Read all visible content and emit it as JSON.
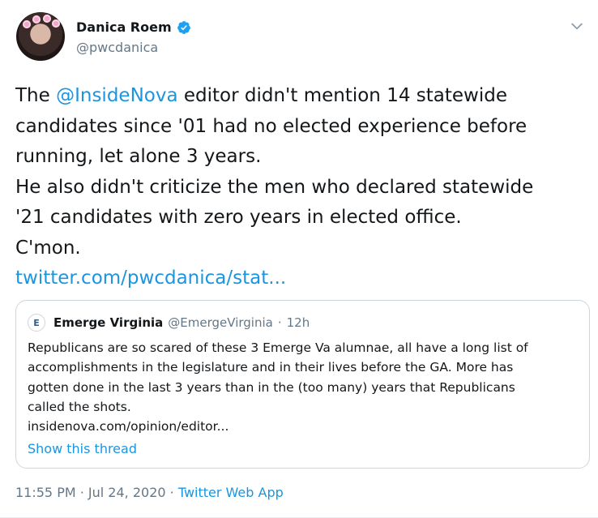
{
  "tweet": {
    "display_name": "Danica Roem",
    "handle": "@pwcdanica",
    "text_lines": [
      {
        "before": "The ",
        "mention": "@InsideNova",
        "after": " editor didn't mention 14 statewide"
      },
      "candidates since '01 had no elected experience before",
      "running, let alone 3 years.",
      "He also didn't criticize the men who declared statewide",
      "'21 candidates with zero years in elected office.",
      "C'mon."
    ],
    "link": "twitter.com/pwcdanica/stat..."
  },
  "quote": {
    "avatar_letter": "E",
    "name": "Emerge Virginia",
    "handle": "@EmergeVirginia",
    "separator": "·",
    "time": "12h",
    "text_lines": [
      "Republicans are so scared of these 3 Emerge Va alumnae, all  have a long list of",
      "accomplishments in the legislature and in their lives before the GA. More has",
      "gotten done in the last 3 years than in the (too many) years that Republicans",
      "called the shots.",
      "insidenova.com/opinion/editor..."
    ],
    "show_thread": "Show this thread"
  },
  "footer": {
    "timestamp": "11:55 PM · Jul 24, 2020",
    "separator": " · ",
    "source": "Twitter Web App"
  },
  "icons": {
    "verified": "verified-badge-icon",
    "chevron": "chevron-down-icon"
  },
  "colors": {
    "link": "#1b95e0",
    "secondary_text": "#657786",
    "border": "#ccd6dd"
  }
}
